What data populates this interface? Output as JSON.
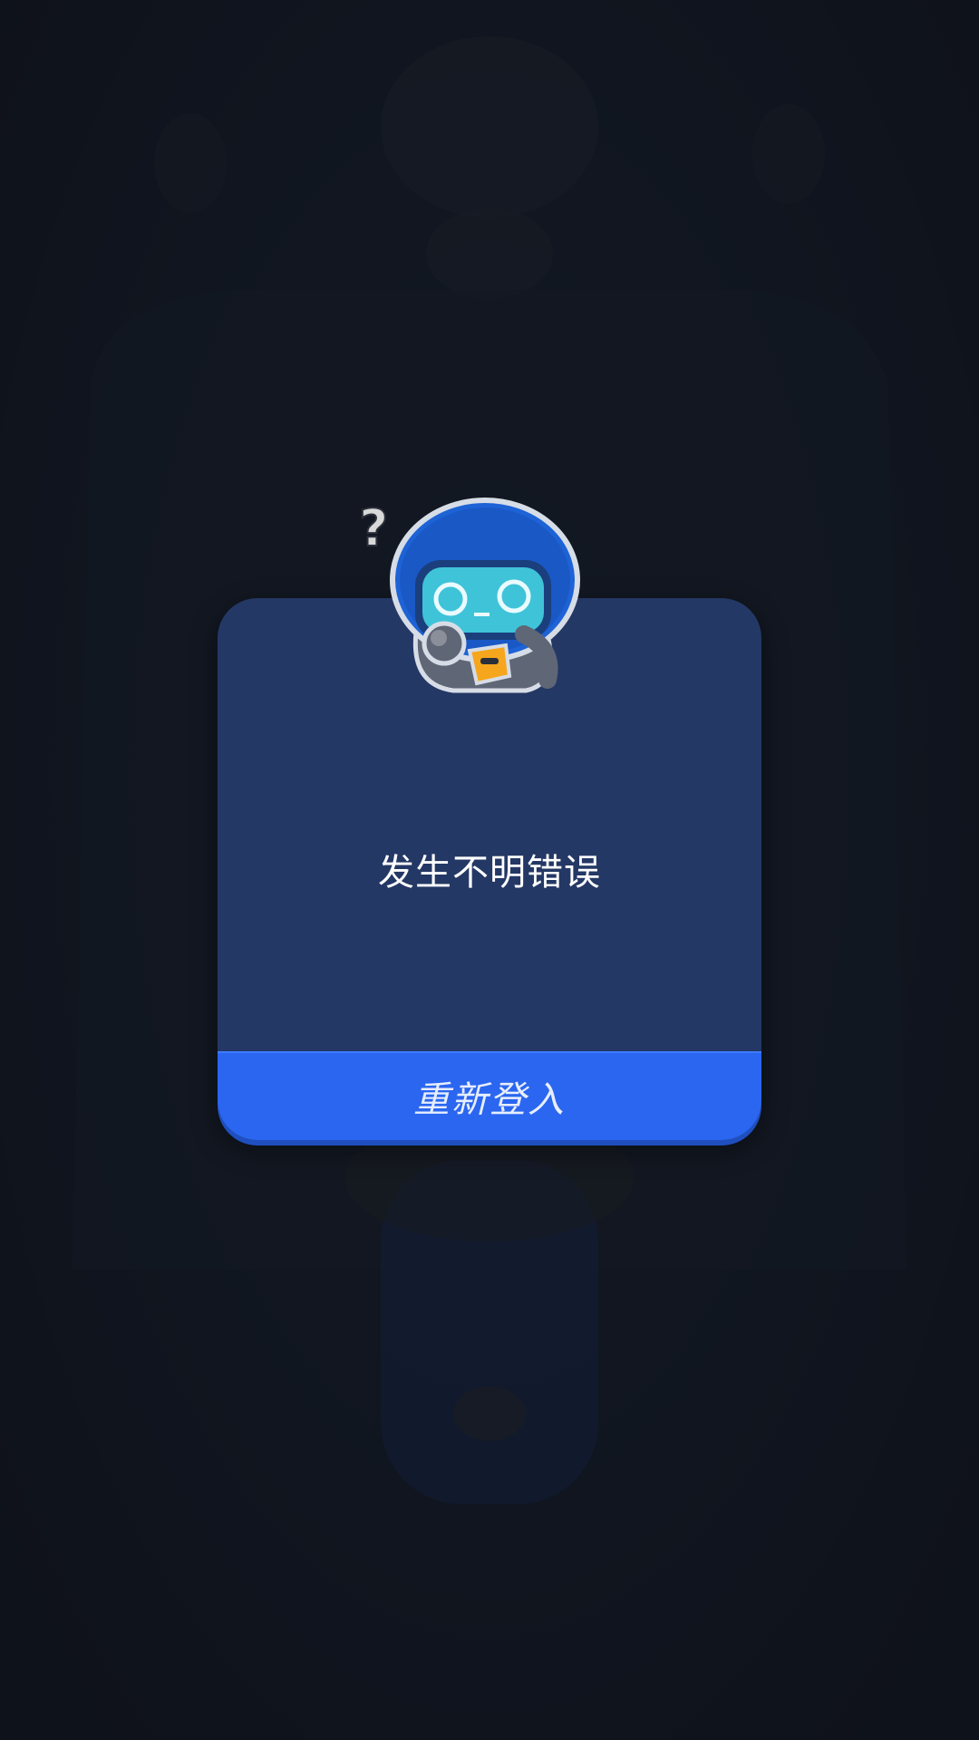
{
  "dialog": {
    "message": "发生不明错误",
    "button_label": "重新登入"
  },
  "mascot": {
    "icon": "confused-robot-mascot-icon",
    "badge": "?"
  },
  "colors": {
    "dialog_bg": "#243865",
    "button_bg": "#2a66ef",
    "page_bg": "#141a26"
  }
}
